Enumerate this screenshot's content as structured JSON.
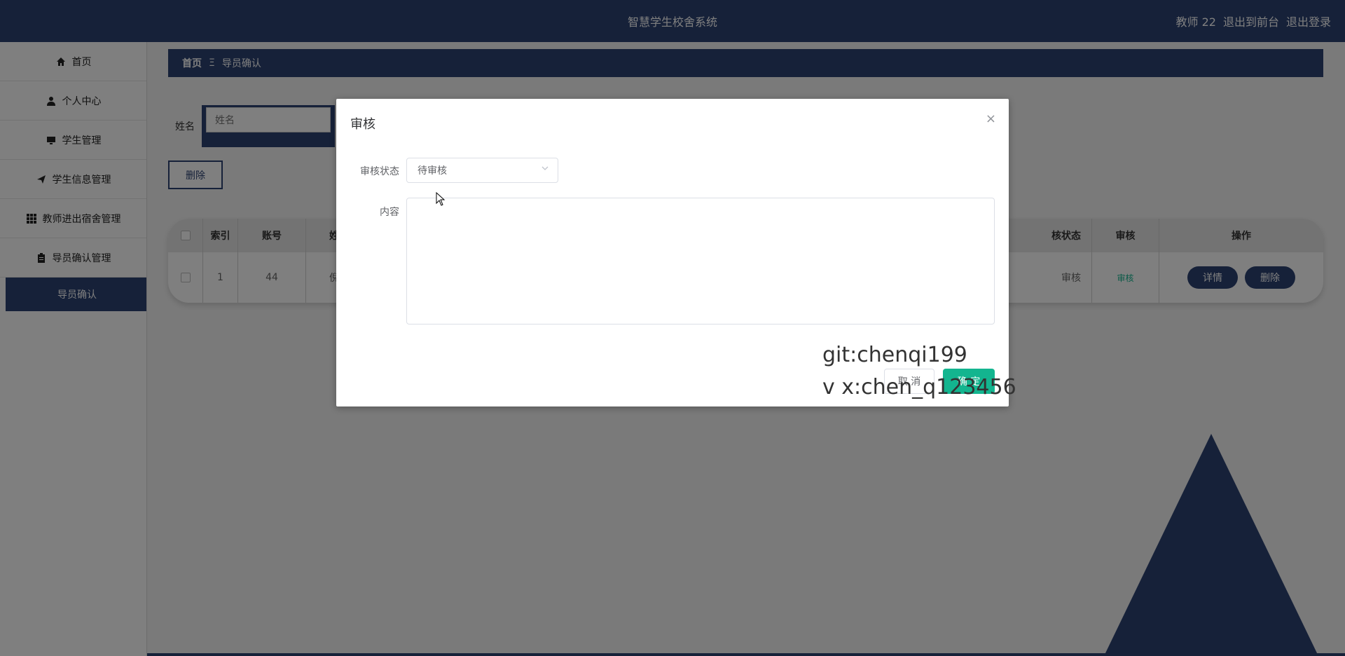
{
  "header": {
    "title": "智慧学生校舍系统",
    "user": "教师 22",
    "to_front": "退出到前台",
    "logout": "退出登录"
  },
  "sidebar": {
    "items": [
      {
        "label": "首页",
        "icon": "home-icon"
      },
      {
        "label": "个人中心",
        "icon": "user-icon"
      },
      {
        "label": "学生管理",
        "icon": "monitor-icon"
      },
      {
        "label": "学生信息管理",
        "icon": "send-icon"
      },
      {
        "label": "教师进出宿舍管理",
        "icon": "grid-icon"
      },
      {
        "label": "导员确认管理",
        "icon": "clipboard-icon"
      }
    ],
    "sub_item": "导员确认"
  },
  "breadcrumb": {
    "home": "首页",
    "separator": "Ξ",
    "current": "导员确认"
  },
  "search": {
    "label": "姓名",
    "placeholder": "姓名"
  },
  "toolbar": {
    "delete_label": "删除"
  },
  "table": {
    "headers": [
      "索引",
      "账号",
      "姓",
      "核状态",
      "审核",
      "操作"
    ],
    "rows": [
      {
        "index": "1",
        "account": "44",
        "name": "倪",
        "status": "审核",
        "audit": "审核",
        "detail": "详情",
        "delete": "删除"
      }
    ]
  },
  "dialog": {
    "title": "审核",
    "close": "×",
    "status_label": "审核状态",
    "status_value": "待审核",
    "content_label": "内容",
    "cancel": "取 消",
    "confirm": "确 定"
  },
  "watermark": {
    "line1": "git:chenqi199",
    "line2": "v x:chen_q123456"
  },
  "colors": {
    "primary": "#2d4272",
    "accent": "#13b58f"
  }
}
